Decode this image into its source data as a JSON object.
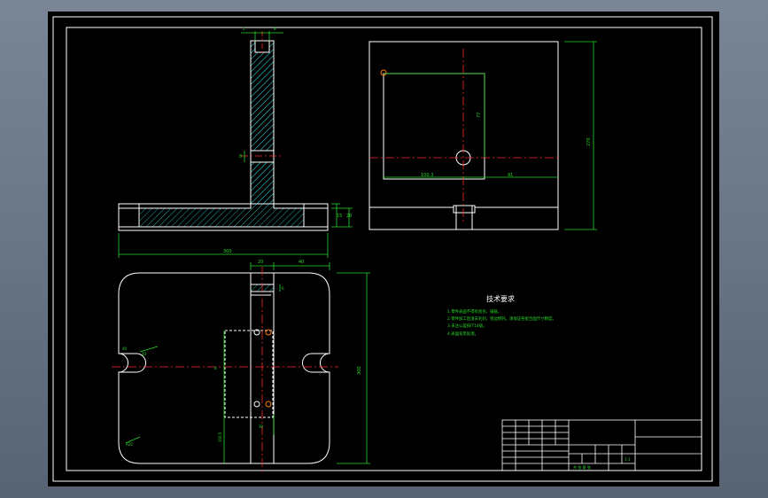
{
  "drawing": {
    "dimensions": {
      "side_width": "300",
      "side_h1": "15",
      "side_h2": "20",
      "side_hole": "8",
      "side_top_left": "2",
      "side_top_right": "6",
      "top_right_overall": "270",
      "top_right_inner": "77",
      "top_right_left": "100.3",
      "top_right_right": "91",
      "plan_a": "20",
      "plan_b": "40",
      "plan_height": "300",
      "plan_c": "6",
      "plan_d": "40",
      "plan_e": "20",
      "plan_f": "100.5",
      "plan_g": "30",
      "plan_r": "R20",
      "plan_side": "8"
    },
    "notes": {
      "title": "技术要求",
      "lines": [
        "1.零件表面不得有划伤、磕碰。",
        "2.零件加工后须去毛刺，锐边倒钝，须保证各配合面尺寸精度。",
        "3.未注公差按IT14级。",
        "4.表面发黑处理。"
      ]
    },
    "title_block": {
      "scale": "1:1",
      "sheet": "共 张 第 张"
    }
  }
}
